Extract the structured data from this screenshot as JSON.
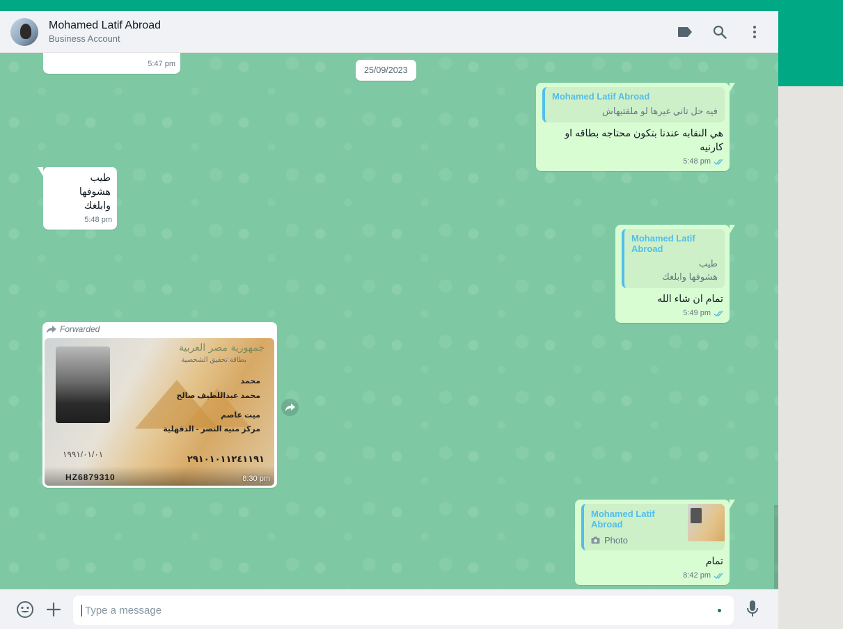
{
  "header": {
    "contact_name": "Mohamed Latif Abroad",
    "contact_subtitle": "Business Account"
  },
  "colors": {
    "accent": "#00a884",
    "chat_background": "#7ec9a4",
    "incoming_bubble": "#ffffff",
    "outgoing_bubble": "#d9fdd3",
    "quote_author": "#53bdeb",
    "read_ticks": "#53bdeb"
  },
  "icons": [
    "label-icon",
    "search-icon",
    "menu-dots-icon",
    "emoji-icon",
    "attach-plus-icon",
    "microphone-icon",
    "forward-icon",
    "camera-icon",
    "double-check-icon"
  ],
  "chat": {
    "date_chip": "25/09/2023",
    "msg0": {
      "time": "5:47 pm"
    },
    "msg1": {
      "quote_author": "Mohamed Latif Abroad",
      "quote_text": "فيه حل تاني غيرها لو ملقتيهاش",
      "text": "هي النقابه عندنا بتكون محتاجه بطاقه او كارنيه",
      "time": "5:48 pm"
    },
    "msg2": {
      "line1": "طيب",
      "line2": "هشوفها وابلغك",
      "time": "5:48 pm"
    },
    "msg3": {
      "quote_author": "Mohamed Latif Abroad",
      "quote_line1": "طيب",
      "quote_line2": "هشوفها وابلغك",
      "text": "تمام ان شاء الله",
      "time": "5:49 pm"
    },
    "msg4": {
      "forwarded_label": "Forwarded",
      "time": "8:30 pm",
      "card": {
        "title": "جمهورية مصر العربية",
        "subtitle": "بطاقة تحقيق الشخصية",
        "line1": "محمد",
        "line2": "محمد عبداللطيف صالح",
        "line3": "ميت عاصم",
        "line4": "مركز منيه النصر - الدقهلية",
        "national_id": "٢٩١٠١٠١١٢٤١١٩١",
        "birth_date": "١٩٩١/٠١/٠١",
        "code": "HZ6879310"
      }
    },
    "msg5": {
      "quote_author": "Mohamed Latif Abroad",
      "quote_media_label": "Photo",
      "text": "تمام",
      "time": "8:42 pm"
    }
  },
  "composer": {
    "placeholder": "Type a message"
  }
}
